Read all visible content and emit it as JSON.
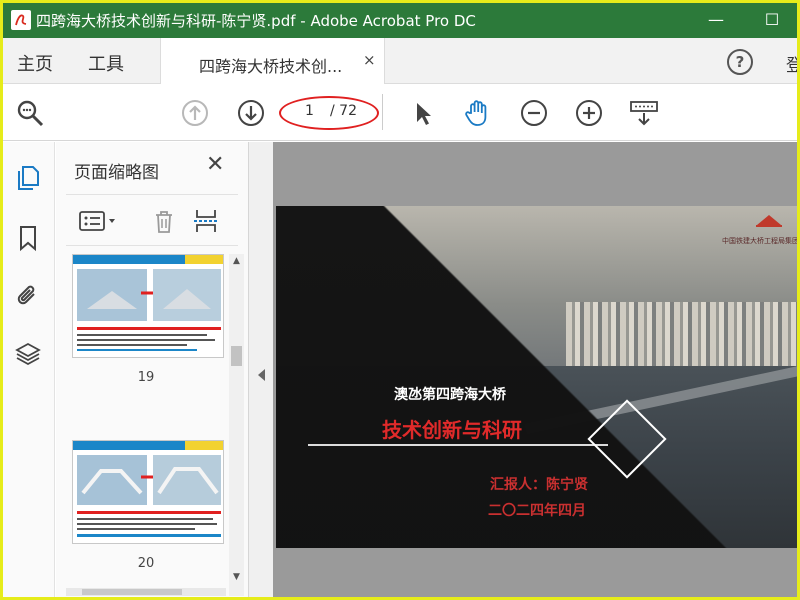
{
  "window": {
    "title": "四跨海大桥技术创新与科研-陈宁贤.pdf - Adobe Acrobat Pro DC",
    "minimize_glyph": "—",
    "maximize_glyph": "☐"
  },
  "menu": {
    "home": "主页",
    "tools": "工具",
    "document_tab": "四跨海大桥技术创...",
    "tab_close": "×",
    "help": "?",
    "signin_partial": "登"
  },
  "toolbar": {
    "page_current": "1",
    "page_total": "/ 72",
    "icons": [
      "search-zoom-icon",
      "page-up-icon",
      "page-down-icon",
      "select-pointer-icon",
      "hand-tool-icon",
      "zoom-out-icon",
      "zoom-in-icon",
      "keyboard-tool-icon"
    ]
  },
  "thumbnail_panel": {
    "title": "页面缩略图",
    "close": "✕",
    "pages": [
      {
        "number": "19"
      },
      {
        "number": "20"
      }
    ]
  },
  "slide": {
    "org_name": "中国铁建大桥工程局集团有",
    "subtitle": "澳氹第四跨海大桥",
    "title": "技术创新与科研",
    "reporter": "汇报人：陈宁贤",
    "date": "二〇二四年四月"
  },
  "colors": {
    "titlebar": "#2c7a3a",
    "accent_blue": "#1a7ac4",
    "highlight_red": "#e02020",
    "slide_title_red": "#e02a2a"
  }
}
